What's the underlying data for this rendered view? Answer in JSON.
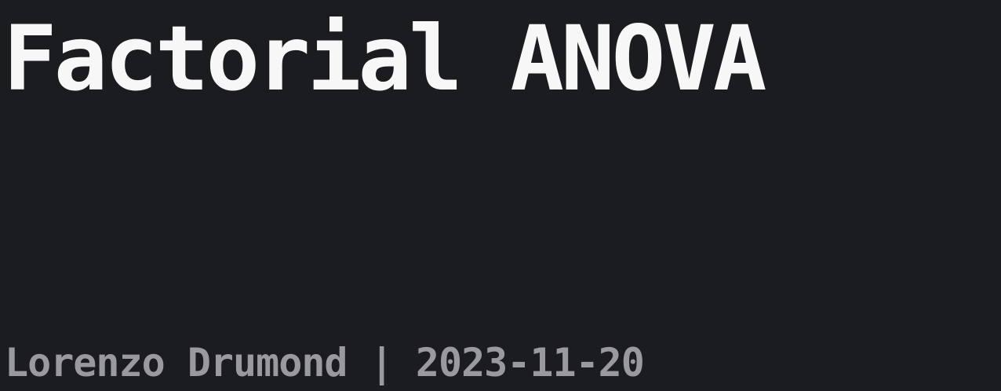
{
  "slide": {
    "title": "Factorial ANOVA",
    "author": "Lorenzo Drumond",
    "separator": " | ",
    "date": "2023-11-20"
  },
  "colors": {
    "background": "#1b1c20",
    "title": "#f7f7f7",
    "byline": "#9a9a9e"
  }
}
